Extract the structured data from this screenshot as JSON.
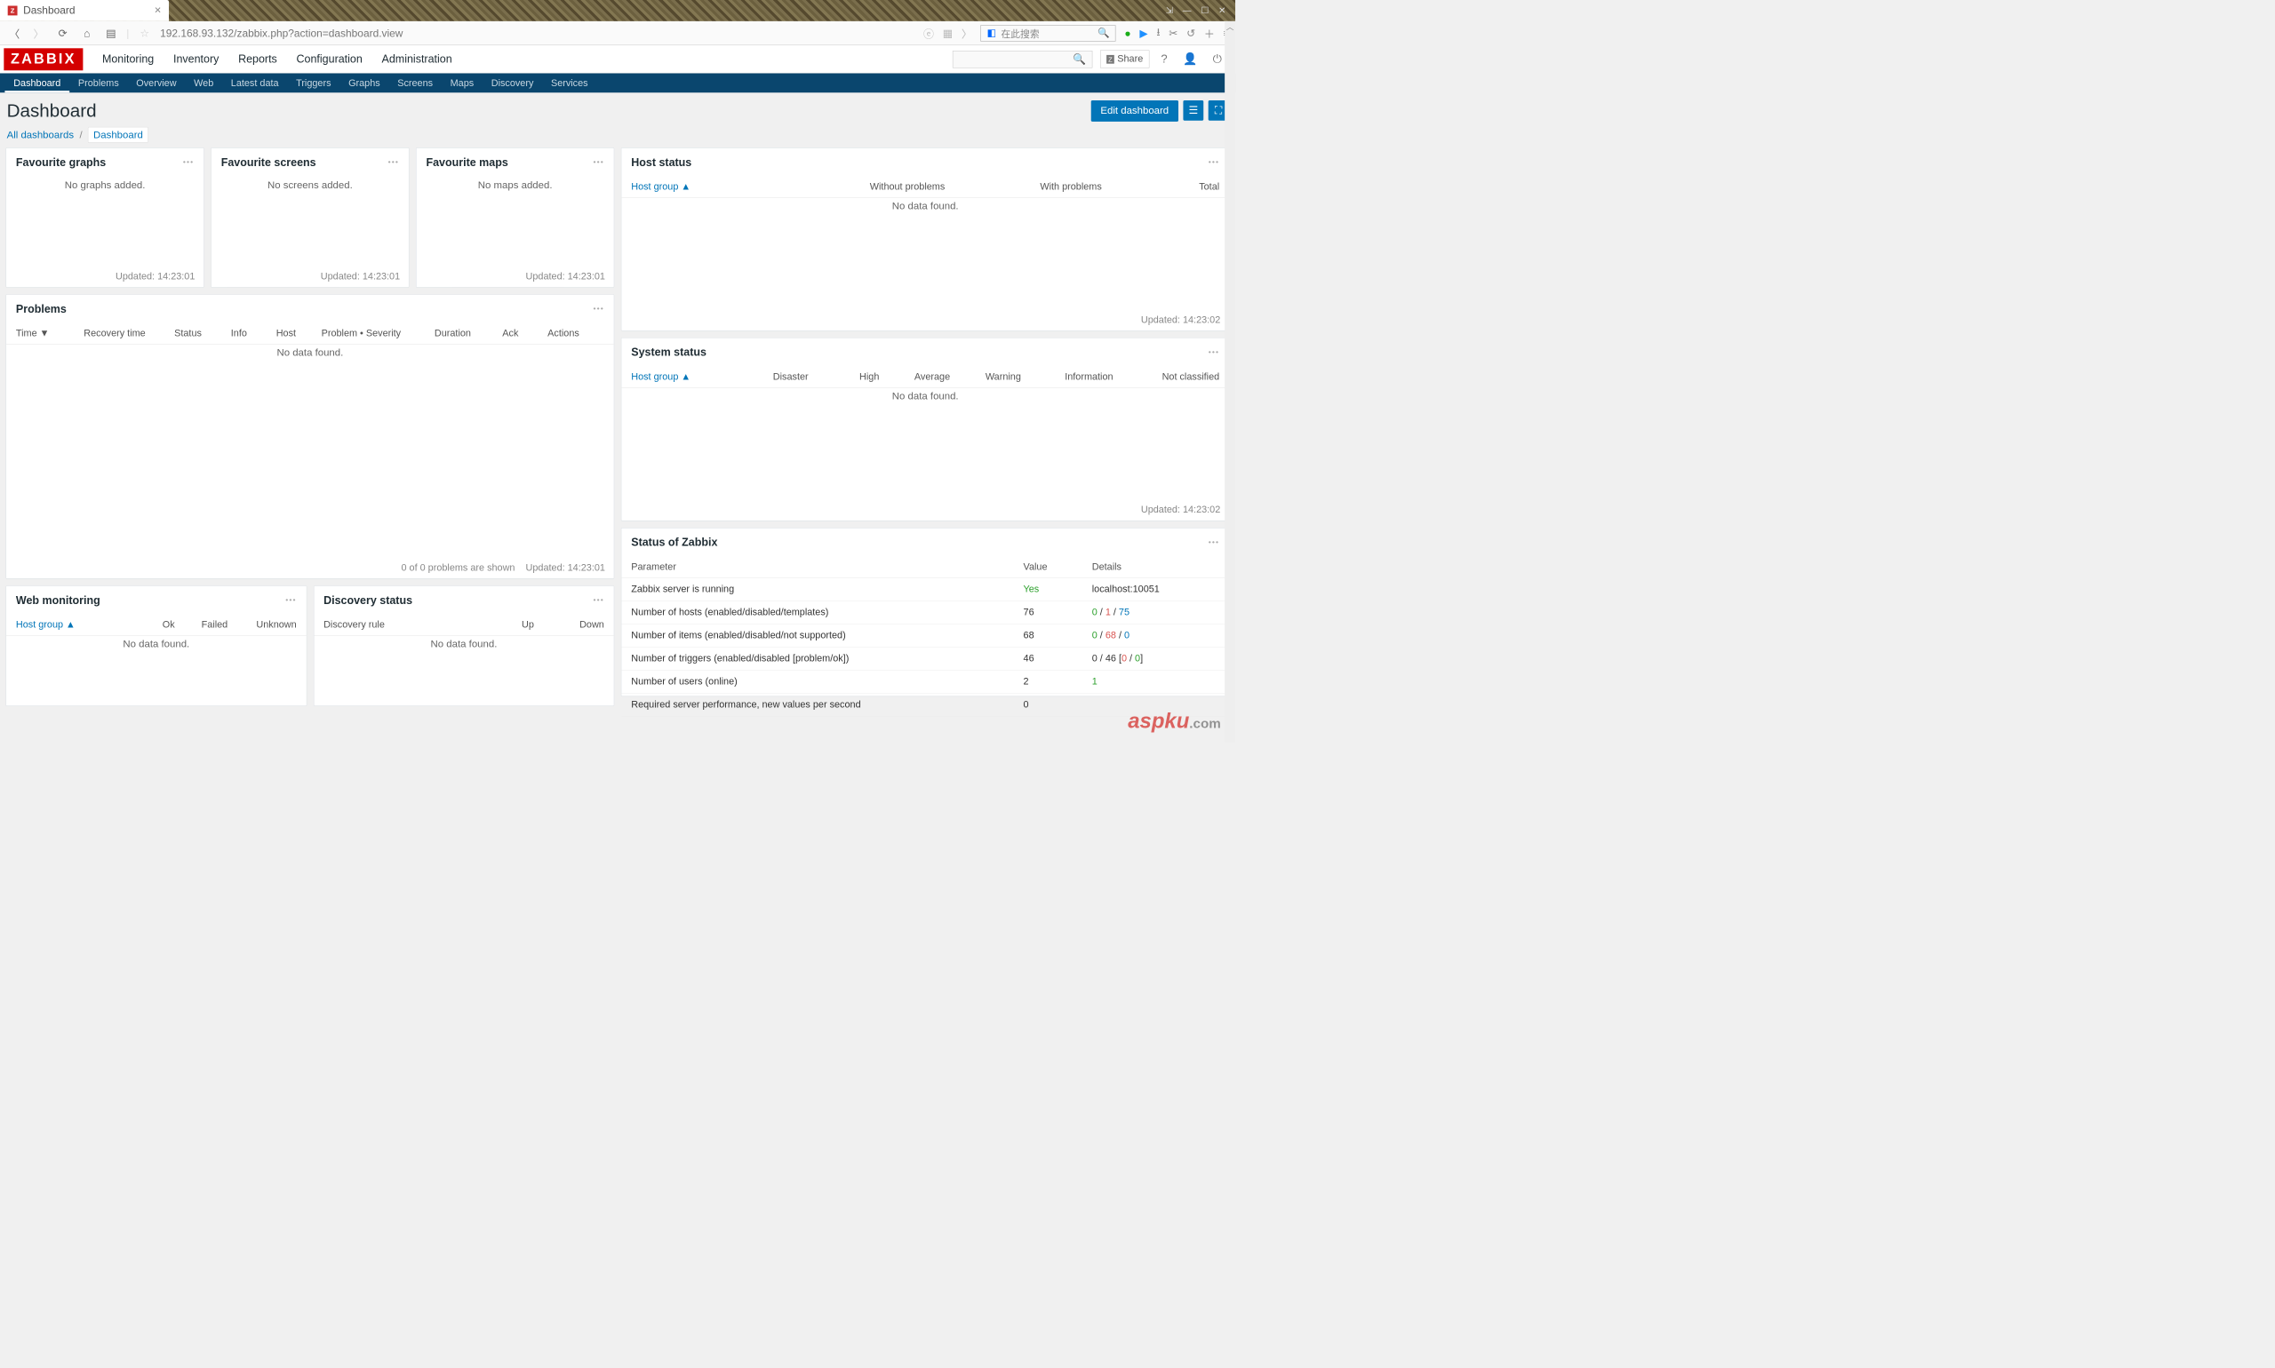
{
  "browser": {
    "tab_title": "Dashboard",
    "url": "192.168.93.132/zabbix.php?action=dashboard.view",
    "search_placeholder": "在此搜索"
  },
  "header": {
    "logo": "ZABBIX",
    "menu": [
      "Monitoring",
      "Inventory",
      "Reports",
      "Configuration",
      "Administration"
    ],
    "active_menu": 0,
    "share": "Share"
  },
  "submenu": {
    "items": [
      "Dashboard",
      "Problems",
      "Overview",
      "Web",
      "Latest data",
      "Triggers",
      "Graphs",
      "Screens",
      "Maps",
      "Discovery",
      "Services"
    ],
    "active": 0
  },
  "page": {
    "title": "Dashboard",
    "edit_btn": "Edit dashboard",
    "breadcrumb_all": "All dashboards",
    "breadcrumb_current": "Dashboard"
  },
  "widgets": {
    "fav_graphs": {
      "title": "Favourite graphs",
      "empty": "No graphs added.",
      "updated": "Updated: 14:23:01"
    },
    "fav_screens": {
      "title": "Favourite screens",
      "empty": "No screens added.",
      "updated": "Updated: 14:23:01"
    },
    "fav_maps": {
      "title": "Favourite maps",
      "empty": "No maps added.",
      "updated": "Updated: 14:23:01"
    },
    "problems": {
      "title": "Problems",
      "columns": [
        "Time ▼",
        "Recovery time",
        "Status",
        "Info",
        "Host",
        "Problem • Severity",
        "Duration",
        "Ack",
        "Actions"
      ],
      "empty": "No data found.",
      "footer_count": "0 of 0 problems are shown",
      "updated": "Updated: 14:23:01"
    },
    "host_status": {
      "title": "Host status",
      "columns": [
        "Host group ▲",
        "Without problems",
        "With problems",
        "Total"
      ],
      "empty": "No data found.",
      "updated": "Updated: 14:23:02"
    },
    "system_status": {
      "title": "System status",
      "columns": [
        "Host group ▲",
        "Disaster",
        "High",
        "Average",
        "Warning",
        "Information",
        "Not classified"
      ],
      "empty": "No data found.",
      "updated": "Updated: 14:23:02"
    },
    "zabbix_status": {
      "title": "Status of Zabbix",
      "columns": [
        "Parameter",
        "Value",
        "Details"
      ],
      "rows": [
        {
          "param": "Zabbix server is running",
          "value": "Yes",
          "value_class": "green",
          "details": [
            {
              "t": "localhost:10051",
              "c": ""
            }
          ]
        },
        {
          "param": "Number of hosts (enabled/disabled/templates)",
          "value": "76",
          "value_class": "",
          "details": [
            {
              "t": "0",
              "c": "green"
            },
            {
              "t": " / ",
              "c": ""
            },
            {
              "t": "1",
              "c": "red"
            },
            {
              "t": " / ",
              "c": ""
            },
            {
              "t": "75",
              "c": "blue"
            }
          ]
        },
        {
          "param": "Number of items (enabled/disabled/not supported)",
          "value": "68",
          "value_class": "",
          "details": [
            {
              "t": "0",
              "c": "green"
            },
            {
              "t": " / ",
              "c": ""
            },
            {
              "t": "68",
              "c": "red"
            },
            {
              "t": " / ",
              "c": ""
            },
            {
              "t": "0",
              "c": "blue"
            }
          ]
        },
        {
          "param": "Number of triggers (enabled/disabled [problem/ok])",
          "value": "46",
          "value_class": "",
          "details": [
            {
              "t": "0 / 46 [",
              "c": ""
            },
            {
              "t": "0",
              "c": "red"
            },
            {
              "t": " / ",
              "c": ""
            },
            {
              "t": "0",
              "c": "green"
            },
            {
              "t": "]",
              "c": ""
            }
          ]
        },
        {
          "param": "Number of users (online)",
          "value": "2",
          "value_class": "",
          "details": [
            {
              "t": "1",
              "c": "green"
            }
          ]
        },
        {
          "param": "Required server performance, new values per second",
          "value": "0",
          "value_class": "",
          "details": [
            {
              "t": "",
              "c": ""
            }
          ]
        }
      ]
    },
    "web_monitoring": {
      "title": "Web monitoring",
      "columns": [
        "Host group ▲",
        "Ok",
        "Failed",
        "Unknown"
      ],
      "empty": "No data found."
    },
    "discovery_status": {
      "title": "Discovery status",
      "columns": [
        "Discovery rule",
        "Up",
        "Down"
      ],
      "empty": "No data found."
    }
  },
  "watermark": {
    "main": "aspku",
    "sub": ".com"
  }
}
